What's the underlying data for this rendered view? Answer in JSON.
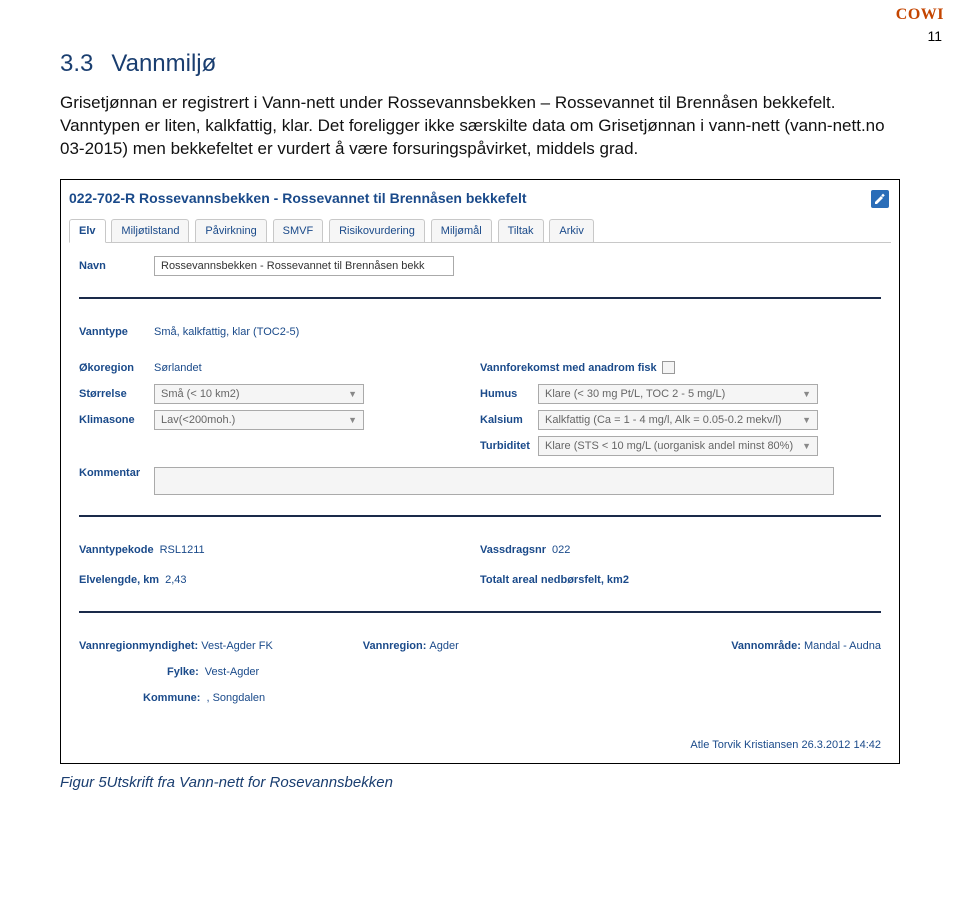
{
  "brand": "COWI",
  "page_number": "11",
  "heading_number": "3.3",
  "heading_title": "Vannmiljø",
  "body_text": "Grisetjønnan er registrert i Vann-nett under Rossevannsbekken – Rossevannet til Brennåsen bekkefelt. Vanntypen er liten, kalkfattig, klar. Det foreligger ikke særskilte data om Grisetjønnan i vann-nett (vann-nett.no 03-2015) men bekkefeltet er vurdert å være forsuringspåvirket, middels grad.",
  "caption": "Figur 5Utskrift fra Vann-nett for Rosevannsbekken",
  "ss": {
    "title": "022-702-R Rossevannsbekken - Rossevannet til Brennåsen bekkefelt",
    "tabs": [
      "Elv",
      "Miljøtilstand",
      "Påvirkning",
      "SMVF",
      "Risikovurdering",
      "Miljømål",
      "Tiltak",
      "Arkiv"
    ],
    "navn_lbl": "Navn",
    "navn_val": "Rossevannsbekken - Rossevannet til Brennåsen bekk",
    "vanntype_lbl": "Vanntype",
    "vanntype_val": "Små, kalkfattig, klar (TOC2-5)",
    "okoregion_lbl": "Økoregion",
    "okoregion_val": "Sørlandet",
    "anadrom_lbl": "Vannforekomst med anadrom fisk",
    "storrelse_lbl": "Størrelse",
    "storrelse_val": "Små (< 10 km2)",
    "humus_lbl": "Humus",
    "humus_val": "Klare (< 30 mg Pt/L, TOC 2 - 5 mg/L)",
    "klimasone_lbl": "Klimasone",
    "klimasone_val": "Lav(<200moh.)",
    "kalsium_lbl": "Kalsium",
    "kalsium_val": "Kalkfattig (Ca = 1 - 4 mg/l, Alk = 0.05-0.2 mekv/l)",
    "turbiditet_lbl": "Turbiditet",
    "turbiditet_val": "Klare (STS < 10 mg/L (uorganisk andel minst 80%)",
    "kommentar_lbl": "Kommentar",
    "vanntypekode_lbl": "Vanntypekode",
    "vanntypekode_val": "RSL1211",
    "vassdragsnr_lbl": "Vassdragsnr",
    "vassdragsnr_val": "022",
    "elvelengde_lbl": "Elvelengde, km",
    "elvelengde_val": "2,43",
    "areal_lbl": "Totalt areal nedbørsfelt, km2",
    "vannregionmyndighet_lbl": "Vannregionmyndighet:",
    "vannregionmyndighet_val": "Vest-Agder FK",
    "vannregion_lbl": "Vannregion:",
    "vannregion_val": "Agder",
    "vannomrade_lbl": "Vannområde:",
    "vannomrade_val": "Mandal - Audna",
    "fylke_lbl": "Fylke:",
    "fylke_val": "Vest-Agder",
    "kommune_lbl": "Kommune:",
    "kommune_val": ", Songdalen",
    "signature": "Atle Torvik Kristiansen 26.3.2012 14:42"
  }
}
